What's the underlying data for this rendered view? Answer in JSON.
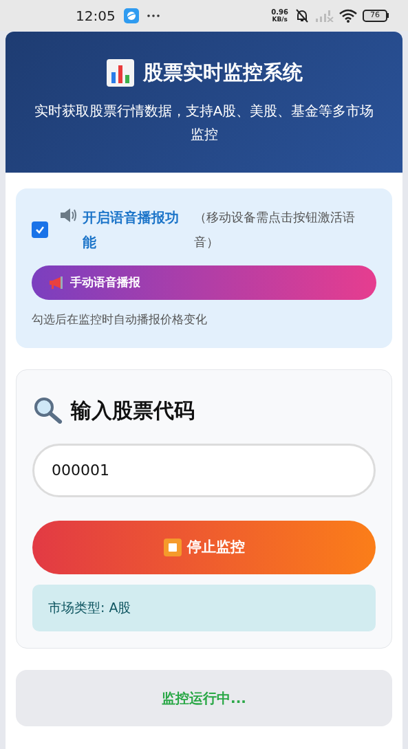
{
  "status_bar": {
    "time": "12:05",
    "speed_value": "0.96",
    "speed_unit": "KB/s",
    "battery": "76"
  },
  "header": {
    "title": "股票实时监控系统",
    "subtitle": "实时获取股票行情数据，支持A股、美股、基金等多市场监控"
  },
  "voice": {
    "checkbox": {
      "label": "开启语音播报功能",
      "checked": true
    },
    "note": "（移动设备需点击按钮激活语音）",
    "button": "手动语音播报",
    "hint": "勾选后在监控时自动播报价格变化"
  },
  "search": {
    "heading": "输入股票代码",
    "input": {
      "value": "000001"
    },
    "button": "停止监控",
    "market_type": "市场类型: A股"
  },
  "status": {
    "text": "监控运行中..."
  }
}
